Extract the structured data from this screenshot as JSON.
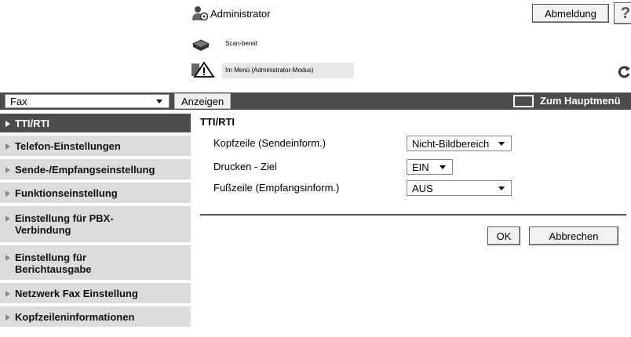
{
  "header": {
    "user_label": "Administrator",
    "logout_label": "Abmeldung",
    "help_label": "?"
  },
  "status": {
    "scanner": "Scan-bereit",
    "device": "Im Menü (Administrator-Modus)"
  },
  "toolbar": {
    "mode_select_value": "Fax",
    "display_button_label": "Anzeigen",
    "main_menu_label": "Zum Hauptmenü"
  },
  "sidebar": {
    "items": [
      {
        "label": "TTI/RTI",
        "active": true
      },
      {
        "label": "Telefon-Einstellungen"
      },
      {
        "label": "Sende-/Empfangseinstellung"
      },
      {
        "label": "Funktionseinstellung"
      },
      {
        "label": "Einstellung für PBX-Verbindung"
      },
      {
        "label": "Einstellung für Berichtausgabe"
      },
      {
        "label": "Netzwerk Fax Einstellung"
      },
      {
        "label": "Kopfzeileninformationen"
      }
    ]
  },
  "content": {
    "title": "TTI/RTI",
    "fields": [
      {
        "label": "Kopfzeile (Sendeinform.)",
        "value": "Nicht-Bildbereich"
      },
      {
        "label": "Drucken - Ziel",
        "value": "EIN"
      },
      {
        "label": "Fußzeile (Empfangsinform.)",
        "value": "AUS"
      }
    ],
    "ok_label": "OK",
    "cancel_label": "Abbrechen"
  }
}
